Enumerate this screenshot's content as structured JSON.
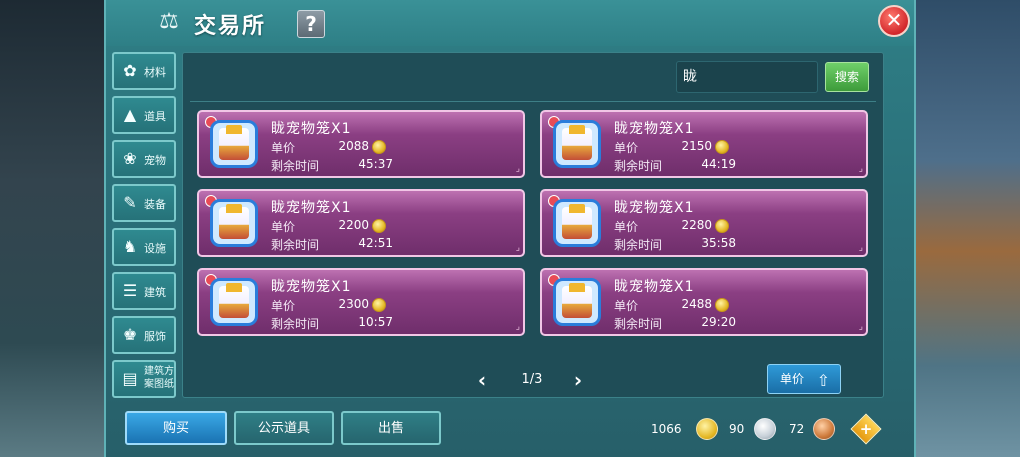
{
  "window": {
    "title": "交易所",
    "help_label": "?",
    "close_label": "✕"
  },
  "sidebar": {
    "items": [
      {
        "label": "材料",
        "icon": "materials-icon"
      },
      {
        "label": "道具",
        "icon": "props-icon"
      },
      {
        "label": "宠物",
        "icon": "paw-icon"
      },
      {
        "label": "装备",
        "icon": "equipment-icon"
      },
      {
        "label": "设施",
        "icon": "facility-icon"
      },
      {
        "label": "建筑",
        "icon": "building-icon"
      },
      {
        "label": "服饰",
        "icon": "clothing-icon"
      },
      {
        "label": "建筑方案图纸",
        "icon": "blueprint-icon"
      }
    ]
  },
  "search": {
    "value": "眬",
    "button_label": "搜索"
  },
  "listings": [
    {
      "name": "眬宠物笼X1",
      "price_label": "单价",
      "price": "2088",
      "time_label": "剩余时间",
      "time": "45:37"
    },
    {
      "name": "眬宠物笼X1",
      "price_label": "单价",
      "price": "2150",
      "time_label": "剩余时间",
      "time": "44:19"
    },
    {
      "name": "眬宠物笼X1",
      "price_label": "单价",
      "price": "2200",
      "time_label": "剩余时间",
      "time": "42:51"
    },
    {
      "name": "眬宠物笼X1",
      "price_label": "单价",
      "price": "2280",
      "time_label": "剩余时间",
      "time": "35:58"
    },
    {
      "name": "眬宠物笼X1",
      "price_label": "单价",
      "price": "2300",
      "time_label": "剩余时间",
      "time": "10:57"
    },
    {
      "name": "眬宠物笼X1",
      "price_label": "单价",
      "price": "2488",
      "time_label": "剩余时间",
      "time": "29:20"
    }
  ],
  "pagination": {
    "text": "1/3",
    "prev": "‹",
    "next": "›"
  },
  "sort": {
    "label": "单价",
    "direction": "ascending"
  },
  "bottom_tabs": {
    "buy": "购买",
    "public": "公示道具",
    "sell": "出售"
  },
  "currency": {
    "gold": "1066",
    "silver": "90",
    "copper": "72"
  },
  "colors": {
    "accent_teal": "#2f7f86",
    "card_purple": "#8b3f83",
    "search_green": "#3d9b3a",
    "buy_blue": "#1a73b2",
    "close_red": "#d2272b"
  }
}
